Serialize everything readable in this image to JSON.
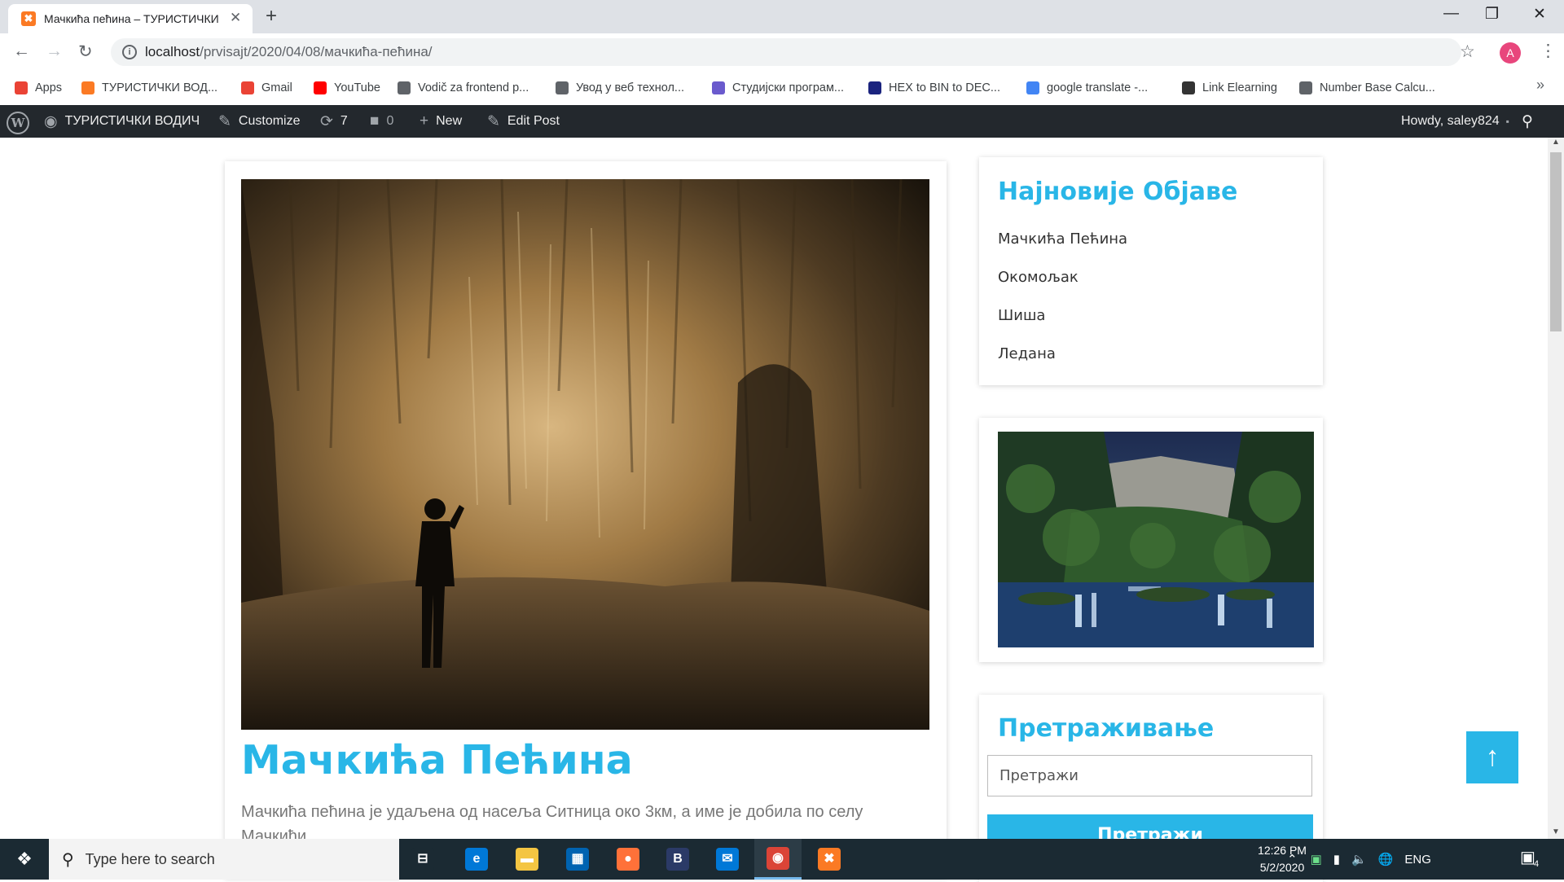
{
  "browser": {
    "tab_title": "Мачкића пећина – ТУРИСТИЧКИ",
    "tab_close": "✕",
    "new_tab": "+",
    "url_host": "localhost",
    "url_path": "/prvisajt/2020/04/08/мачкића-пећина/",
    "profile_initial": "A"
  },
  "bookmarks": [
    {
      "label": "Apps",
      "icon": "apps-grid-icon",
      "color": "#ea4335"
    },
    {
      "label": "ТУРИСТИЧКИ ВОД...",
      "icon": "xampp-icon",
      "color": "#fb7a24"
    },
    {
      "label": "Gmail",
      "icon": "gmail-icon",
      "color": "#ea4335"
    },
    {
      "label": "YouTube",
      "icon": "youtube-icon",
      "color": "#ff0000"
    },
    {
      "label": "Vodič za frontend p...",
      "icon": "globe-icon",
      "color": "#5f6368"
    },
    {
      "label": "Увод у веб технол...",
      "icon": "globe-icon",
      "color": "#5f6368"
    },
    {
      "label": "Студијски програм...",
      "icon": "seal-icon",
      "color": "#6a5acd"
    },
    {
      "label": "HEX to BIN to DEC...",
      "icon": "shield-icon",
      "color": "#1a237e"
    },
    {
      "label": "google translate -...",
      "icon": "google-icon",
      "color": "#4285f4"
    },
    {
      "label": "Link Elearning",
      "icon": "mortarboard-icon",
      "color": "#333333"
    },
    {
      "label": "Number Base Calcu...",
      "icon": "globe-icon",
      "color": "#5f6368"
    }
  ],
  "bookmarks_more": "»",
  "admin_bar": {
    "site_name": "ТУРИСТИЧКИ ВОДИЧ",
    "customize": "Customize",
    "updates_count": "7",
    "comments_count": "0",
    "new_label": "New",
    "edit_post": "Edit Post",
    "howdy": "Howdy, saley824"
  },
  "post": {
    "title": "Мачкића Пећина",
    "excerpt": "Мачкића пећина је удаљена од насеља Ситница око 3км, а име је добила по селу Мачкићи"
  },
  "sidebar": {
    "recent_title": "Најновије Објаве",
    "recent_posts": [
      "Мачкића Пећина",
      "Окомољак",
      "Шиша",
      "Ледана"
    ],
    "search_title": "Претраживање",
    "search_placeholder": "Претражи",
    "search_button": "Претражи"
  },
  "back_to_top": "↑",
  "taskbar": {
    "search_placeholder": "Type here to search",
    "apps": [
      {
        "name": "task-view",
        "glyph": "⊟",
        "color": "#1b2a33"
      },
      {
        "name": "edge",
        "glyph": "e",
        "color": "#0078d7"
      },
      {
        "name": "file-explorer",
        "glyph": "▬",
        "color": "#f4c542"
      },
      {
        "name": "store",
        "glyph": "▦",
        "color": "#0063b1"
      },
      {
        "name": "firefox",
        "glyph": "●",
        "color": "#ff7139"
      },
      {
        "name": "bootstrap-studio",
        "glyph": "B",
        "color": "#2b3a67"
      },
      {
        "name": "mail",
        "glyph": "✉",
        "color": "#0078d7"
      },
      {
        "name": "chrome",
        "glyph": "◉",
        "color": "#db4437"
      },
      {
        "name": "xampp",
        "glyph": "✖",
        "color": "#fb7a24"
      }
    ],
    "language": "ENG",
    "time": "12:26 PM",
    "date": "5/2/2020",
    "notifications": "4"
  },
  "colors": {
    "accent": "#29b6e7",
    "admin_bar": "#23282d",
    "taskbar": "#1b2a33"
  }
}
